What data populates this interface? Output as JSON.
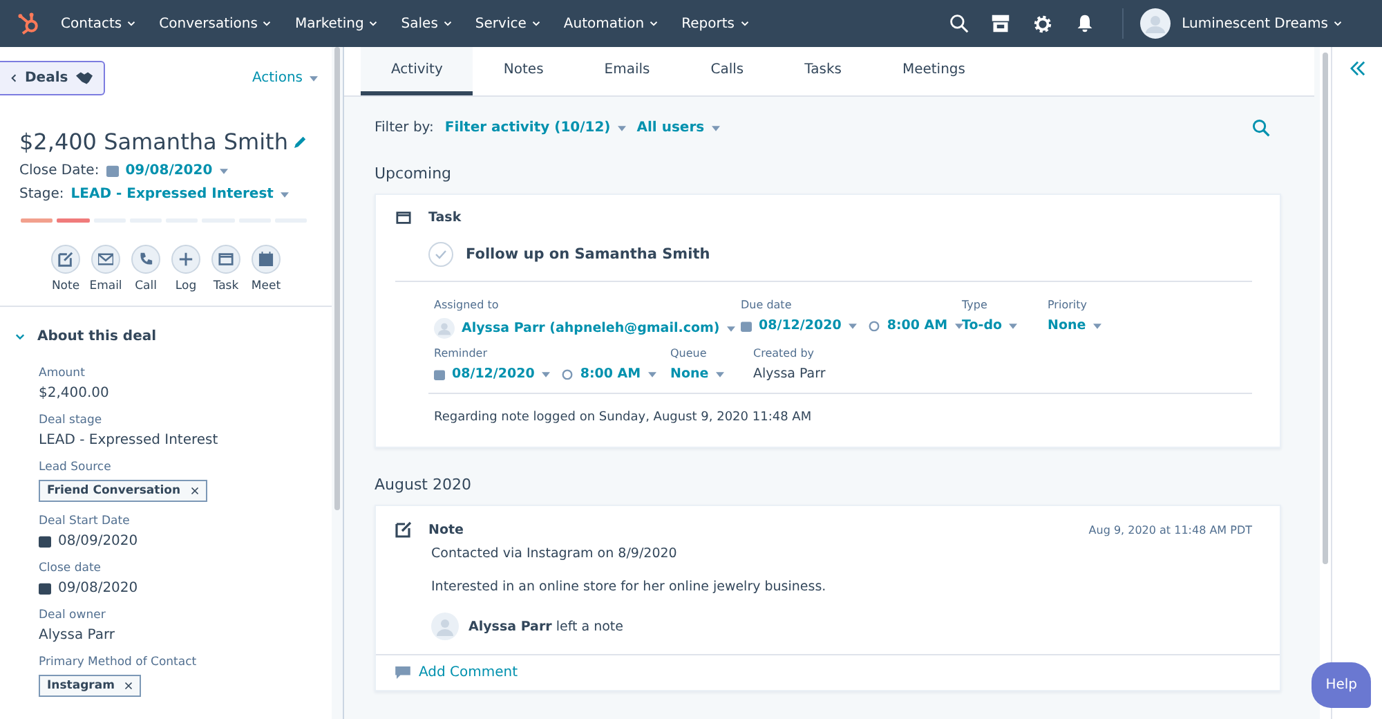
{
  "nav": {
    "menus": [
      "Contacts",
      "Conversations",
      "Marketing",
      "Sales",
      "Service",
      "Automation",
      "Reports"
    ],
    "user": "Luminescent Dreams"
  },
  "left": {
    "back": "Deals",
    "actions": "Actions",
    "title": "$2,400 Samantha Smith",
    "close_date": {
      "label": "Close Date:",
      "value": "09/08/2020"
    },
    "stage": {
      "label": "Stage:",
      "value": "LEAD - Expressed Interest"
    },
    "segments": [
      {
        "color": "#f2a08d"
      },
      {
        "color": "#f07b7b"
      },
      {
        "color": "#eaf0f6"
      },
      {
        "color": "#eaf0f6"
      },
      {
        "color": "#eaf0f6"
      },
      {
        "color": "#eaf0f6"
      },
      {
        "color": "#eaf0f6"
      },
      {
        "color": "#eaf0f6"
      }
    ],
    "quick_actions": [
      {
        "kind": "note",
        "label": "Note"
      },
      {
        "kind": "email",
        "label": "Email"
      },
      {
        "kind": "call",
        "label": "Call"
      },
      {
        "kind": "log",
        "label": "Log"
      },
      {
        "kind": "task",
        "label": "Task"
      },
      {
        "kind": "meet",
        "label": "Meet"
      }
    ],
    "section": {
      "title": "About this deal",
      "expanded": true
    },
    "properties": [
      {
        "label": "Amount",
        "kind": "text",
        "value": "$2,400.00"
      },
      {
        "label": "Deal stage",
        "kind": "text",
        "value": "LEAD - Expressed Interest"
      },
      {
        "label": "Lead Source",
        "kind": "tag",
        "value": "Friend Conversation"
      },
      {
        "label": "Deal Start Date",
        "kind": "date",
        "value": "08/09/2020"
      },
      {
        "label": "Close date",
        "kind": "date",
        "value": "09/08/2020"
      },
      {
        "label": "Deal owner",
        "kind": "text",
        "value": "Alyssa Parr"
      },
      {
        "label": "Primary Method of Contact",
        "kind": "tag",
        "value": "Instagram"
      }
    ]
  },
  "tabs": [
    {
      "label": "Activity",
      "selected": true
    },
    {
      "label": "Notes",
      "selected": false
    },
    {
      "label": "Emails",
      "selected": false
    },
    {
      "label": "Calls",
      "selected": false
    },
    {
      "label": "Tasks",
      "selected": false
    },
    {
      "label": "Meetings",
      "selected": false
    }
  ],
  "filter": {
    "label": "Filter by:",
    "activity": "Filter activity (10/12)",
    "users": "All users"
  },
  "upcoming": {
    "heading": "Upcoming",
    "type": "Task",
    "title": "Follow up on Samantha Smith",
    "assigned": {
      "label": "Assigned to",
      "value": "Alyssa Parr (ahpneleh@gmail.com)"
    },
    "due": {
      "label": "Due date",
      "date": "08/12/2020",
      "time": "8:00 AM"
    },
    "type_field": {
      "label": "Type",
      "value": "To-do"
    },
    "priority": {
      "label": "Priority",
      "value": "None"
    },
    "reminder": {
      "label": "Reminder",
      "date": "08/12/2020",
      "time": "8:00 AM"
    },
    "queue": {
      "label": "Queue",
      "value": "None"
    },
    "created": {
      "label": "Created by",
      "value": "Alyssa Parr"
    },
    "regarding": "Regarding note logged on Sunday, August 9, 2020 11:48 AM"
  },
  "month": {
    "heading": "August 2020",
    "type": "Note",
    "timestamp": "Aug 9, 2020 at 11:48 AM PDT",
    "lines": [
      "Contacted via Instagram on 8/9/2020",
      "Interested in an online store for her online jewelry business."
    ],
    "author": "**Alyssa Parr** left a note",
    "comment": "Add Comment"
  },
  "help": "Help"
}
